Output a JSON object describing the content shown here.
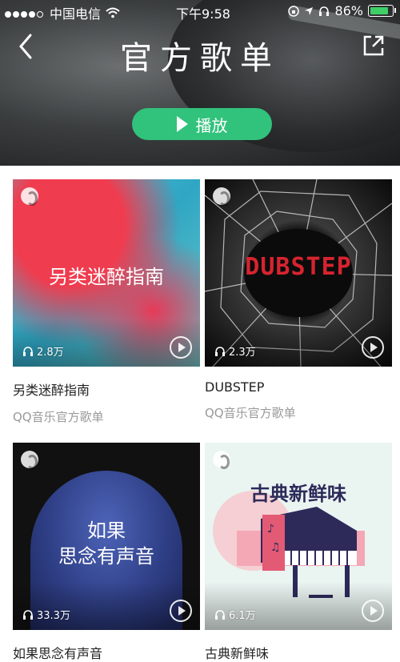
{
  "status_bar": {
    "carrier": "中国电信",
    "time": "下午9:58",
    "battery": "86%",
    "battery_level": 0.86
  },
  "header": {
    "title": "官方歌单",
    "play_label": "播放",
    "back_icon": "chevron-left-icon",
    "share_icon": "share-icon"
  },
  "colors": {
    "accent": "#31c27c"
  },
  "playlists": [
    {
      "name": "另类迷醉指南",
      "subtitle": "QQ音乐官方歌单",
      "plays": "2.8万",
      "cover_text": "另类迷醉指南"
    },
    {
      "name": "DUBSTEP",
      "subtitle": "QQ音乐官方歌单",
      "plays": "2.3万",
      "cover_text": "DUBSTEP"
    },
    {
      "name": "如果思念有声音",
      "plays": "33.3万",
      "cover_text_line1": "如果",
      "cover_text_line2": "思念有声音"
    },
    {
      "name": "古典新鲜味",
      "plays": "6.1万",
      "cover_text": "古典新鲜味"
    }
  ]
}
